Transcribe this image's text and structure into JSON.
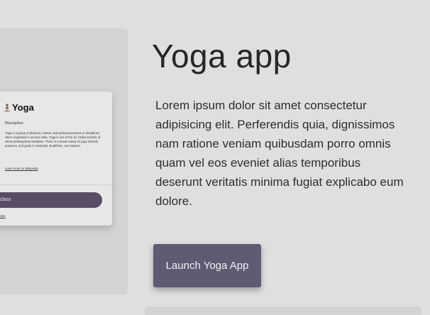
{
  "preview_card": {
    "title": "Yoga",
    "icon": "meditation-icon",
    "discipline_label": "Discipline",
    "description": "Yoga is a group of physical, mental, and spiritual practices or disciplines which originated in ancient India. Yoga is one of the six Āstika schools of Hindu philosophical traditions. There is a broad variety of yoga schools, practices, and goals in Hinduism, Buddhism, and Jainism.",
    "wiki_link": "Learn more on Wikipedia",
    "class_button": "ga class",
    "attribution": "lleCodes"
  },
  "main": {
    "title": "Yoga app",
    "body": "Lorem ipsum dolor sit amet consectetur adipisicing elit. Perferendis quia, dignissimos nam ratione veniam quibusdam porro omnis quam vel eos eveniet alias temporibus deserunt veritatis minima fugiat explicabo eum dolore.",
    "launch_button": "Launch Yoga App"
  },
  "colors": {
    "background": "#dfdfdf",
    "panel": "#d3d3d3",
    "button": "#5f5b73",
    "card_button": "#5a4b66"
  }
}
